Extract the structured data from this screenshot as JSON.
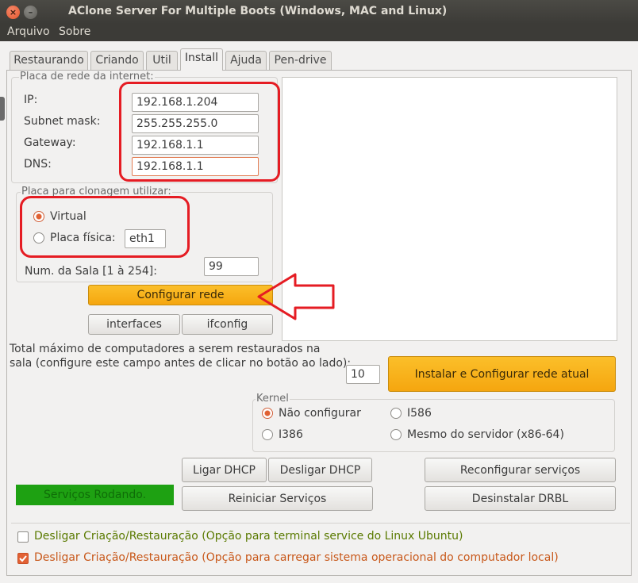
{
  "window": {
    "title": "AClone Server For Multiple Boots (Windows, MAC and Linux)",
    "close_glyph": "×",
    "min_glyph": "–"
  },
  "menu": {
    "items": [
      "Arquivo",
      "Sobre"
    ]
  },
  "tabs": [
    {
      "label": "Restaurando"
    },
    {
      "label": "Criando"
    },
    {
      "label": "Util"
    },
    {
      "label": "Install",
      "active": true
    },
    {
      "label": "Ajuda"
    },
    {
      "label": "Pen-drive"
    }
  ],
  "network": {
    "legend": "Placa de rede da internet:",
    "ip_label": "IP:",
    "ip_value": "192.168.1.204",
    "mask_label": "Subnet mask:",
    "mask_value": "255.255.255.0",
    "gateway_label": "Gateway:",
    "gateway_value": "192.168.1.1",
    "dns_label": "DNS:",
    "dns_value": "192.168.1.1"
  },
  "clone": {
    "legend": "Placa para clonagem utilizar:",
    "virtual_label": "Virtual",
    "physical_label": "Placa física:",
    "physical_value": "eth1",
    "selected": "Virtual"
  },
  "room": {
    "label": "Num. da Sala [1 à 254]:",
    "value": "99"
  },
  "buttons": {
    "configurar_rede": "Configurar rede",
    "interfaces": "interfaces",
    "ifconfig": "ifconfig",
    "instalar": "Instalar e Configurar rede atual",
    "ligar_dhcp": "Ligar DHCP",
    "desligar_dhcp": "Desligar DHCP",
    "reconfigurar": "Reconfigurar serviços",
    "reiniciar": "Reiniciar Serviços",
    "desinstalar": "Desinstalar DRBL"
  },
  "total": {
    "line1": "Total máximo de computadores a serem restaurados na",
    "line2": "sala (configure este campo antes de clicar no botão ao lado):",
    "value": "10"
  },
  "kernel": {
    "legend": "Kernel",
    "options": [
      "Não configurar",
      "I586",
      "I386",
      "Mesmo do servidor (x86-64)"
    ],
    "selected": "Não configurar"
  },
  "status": {
    "text": "Serviços Rodando.",
    "color": "#1ea112"
  },
  "options": {
    "opt1": "Desligar Criação/Restauração (Opção para terminal service do Linux Ubuntu)",
    "opt1_checked": false,
    "opt2": "Desligar Criação/Restauração (Opção para carregar sistema operacional do computador local)",
    "opt2_checked": true
  },
  "colors": {
    "accent": "#f5a60f",
    "annotation": "#e51c23",
    "opt1_text": "#5a7a00",
    "opt2_text": "#c8581a"
  }
}
